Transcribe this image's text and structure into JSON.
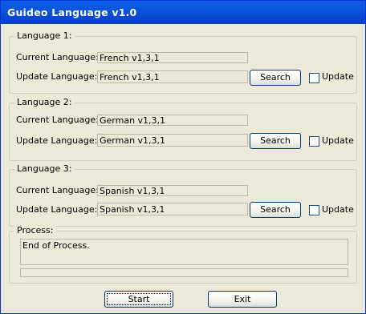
{
  "window": {
    "title": "Guideo Language v1.0"
  },
  "labels": {
    "current": "Current Language:",
    "update": "Update Language:"
  },
  "groups": [
    {
      "legend": "Language 1:",
      "current_value": "French v1,3,1",
      "update_value": "French v1,3,1",
      "search_label": "Search",
      "checkbox_label": "Update",
      "checkbox_checked": false
    },
    {
      "legend": "Language 2:",
      "current_value": "German v1,3,1",
      "update_value": "German v1,3,1",
      "search_label": "Search",
      "checkbox_label": "Update",
      "checkbox_checked": false
    },
    {
      "legend": "Language 3:",
      "current_value": "Spanish v1,3,1",
      "update_value": "Spanish v1,3,1",
      "search_label": "Search",
      "checkbox_label": "Update",
      "checkbox_checked": false
    }
  ],
  "process": {
    "legend": "Process:",
    "output_text": "End of Process."
  },
  "buttons": {
    "start_label": "Start",
    "exit_label": "Exit"
  },
  "colors": {
    "title_bar": "#0b53db",
    "window_bg": "#ece9d8",
    "title_text": "#ffffff"
  }
}
